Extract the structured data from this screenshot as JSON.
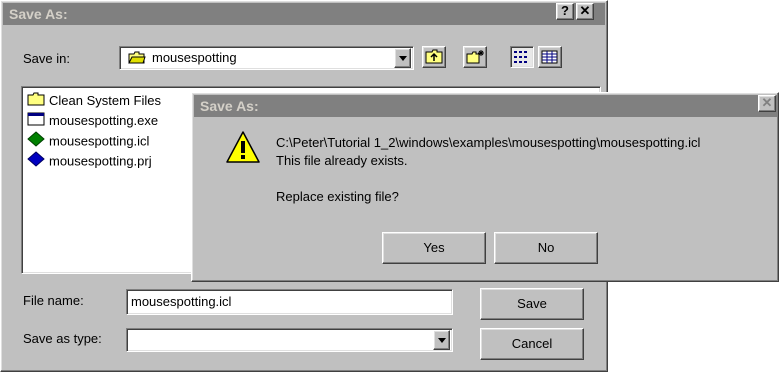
{
  "save_dialog": {
    "title": "Save As:",
    "help_glyph": "?",
    "close_glyph": "✕",
    "save_in_label": "Save in:",
    "save_in_value": "mousespotting",
    "files": [
      {
        "name": "Clean System Files",
        "icon": "folder-icon"
      },
      {
        "name": "mousespotting.exe",
        "icon": "exe-window-icon"
      },
      {
        "name": "mousespotting.icl",
        "icon": "green-diamond-icon"
      },
      {
        "name": "mousespotting.prj",
        "icon": "blue-diamond-icon"
      }
    ],
    "file_name_label": "File name:",
    "file_name_value": "mousespotting.icl",
    "save_as_type_label": "Save as type:",
    "save_as_type_value": "",
    "save_button": "Save",
    "cancel_button": "Cancel"
  },
  "confirm_dialog": {
    "title": "Save As:",
    "path": "C:\\Peter\\Tutorial 1_2\\windows\\examples\\mousespotting\\mousespotting.icl",
    "message": "This file already exists.",
    "question": "Replace existing file?",
    "yes_button": "Yes",
    "no_button": "No",
    "icon": "warning-icon"
  }
}
